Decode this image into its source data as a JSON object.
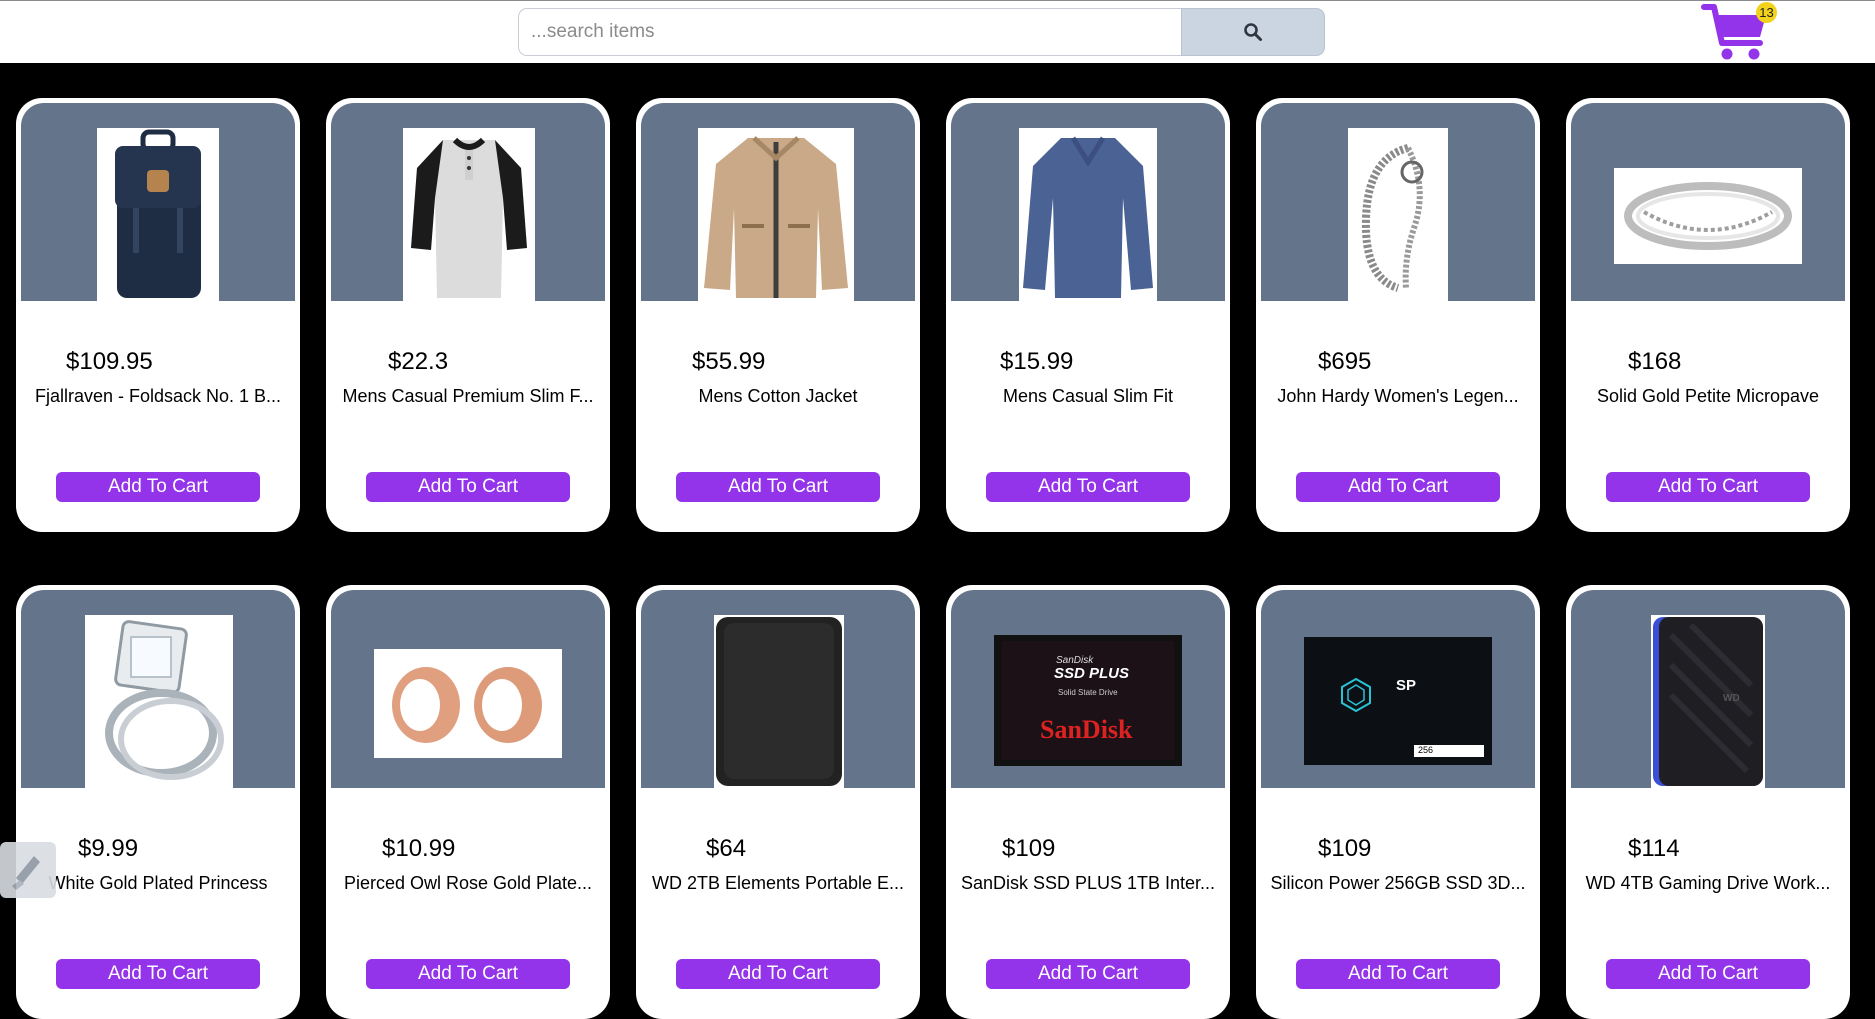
{
  "search": {
    "placeholder": "...search items"
  },
  "cart": {
    "count": "13",
    "accent": "#9333ea"
  },
  "colors": {
    "button": "#9333ea",
    "image_bg": "#64748b",
    "badge": "#f2d21b"
  },
  "products": [
    {
      "price": "$109.95",
      "title": "Fjallraven - Foldsack No. 1 B...",
      "button": "Add To Cart",
      "icon": "backpack-image"
    },
    {
      "price": "$22.3",
      "title": "Mens Casual Premium Slim F...",
      "button": "Add To Cart",
      "icon": "raglan-shirt-image"
    },
    {
      "price": "$55.99",
      "title": "Mens Cotton Jacket",
      "button": "Add To Cart",
      "icon": "jacket-image"
    },
    {
      "price": "$15.99",
      "title": "Mens Casual Slim Fit",
      "button": "Add To Cart",
      "icon": "longsleeve-shirt-image"
    },
    {
      "price": "$695",
      "title": "John Hardy Women's Legen...",
      "button": "Add To Cart",
      "icon": "bracelet-image"
    },
    {
      "price": "$168",
      "title": "Solid Gold Petite Micropave",
      "button": "Add To Cart",
      "icon": "ring-image"
    },
    {
      "price": "$9.99",
      "title": "White Gold Plated Princess",
      "button": "Add To Cart",
      "icon": "diamond-ring-image"
    },
    {
      "price": "$10.99",
      "title": "Pierced Owl Rose Gold Plate...",
      "button": "Add To Cart",
      "icon": "plug-earrings-image"
    },
    {
      "price": "$64",
      "title": "WD 2TB Elements Portable E...",
      "button": "Add To Cart",
      "icon": "hard-drive-image"
    },
    {
      "price": "$109",
      "title": "SanDisk SSD PLUS 1TB Inter...",
      "button": "Add To Cart",
      "icon": "ssd-image",
      "image_text": [
        "SanDisk",
        "SSD PLUS",
        "Solid State Drive",
        "SanDisk"
      ]
    },
    {
      "price": "$109",
      "title": "Silicon Power 256GB SSD 3D...",
      "button": "Add To Cart",
      "icon": "ssd-image",
      "image_text": [
        "SP",
        "256"
      ]
    },
    {
      "price": "$114",
      "title": "WD 4TB Gaming Drive Work...",
      "button": "Add To Cart",
      "icon": "gaming-drive-image",
      "image_text": [
        "WD"
      ]
    }
  ]
}
